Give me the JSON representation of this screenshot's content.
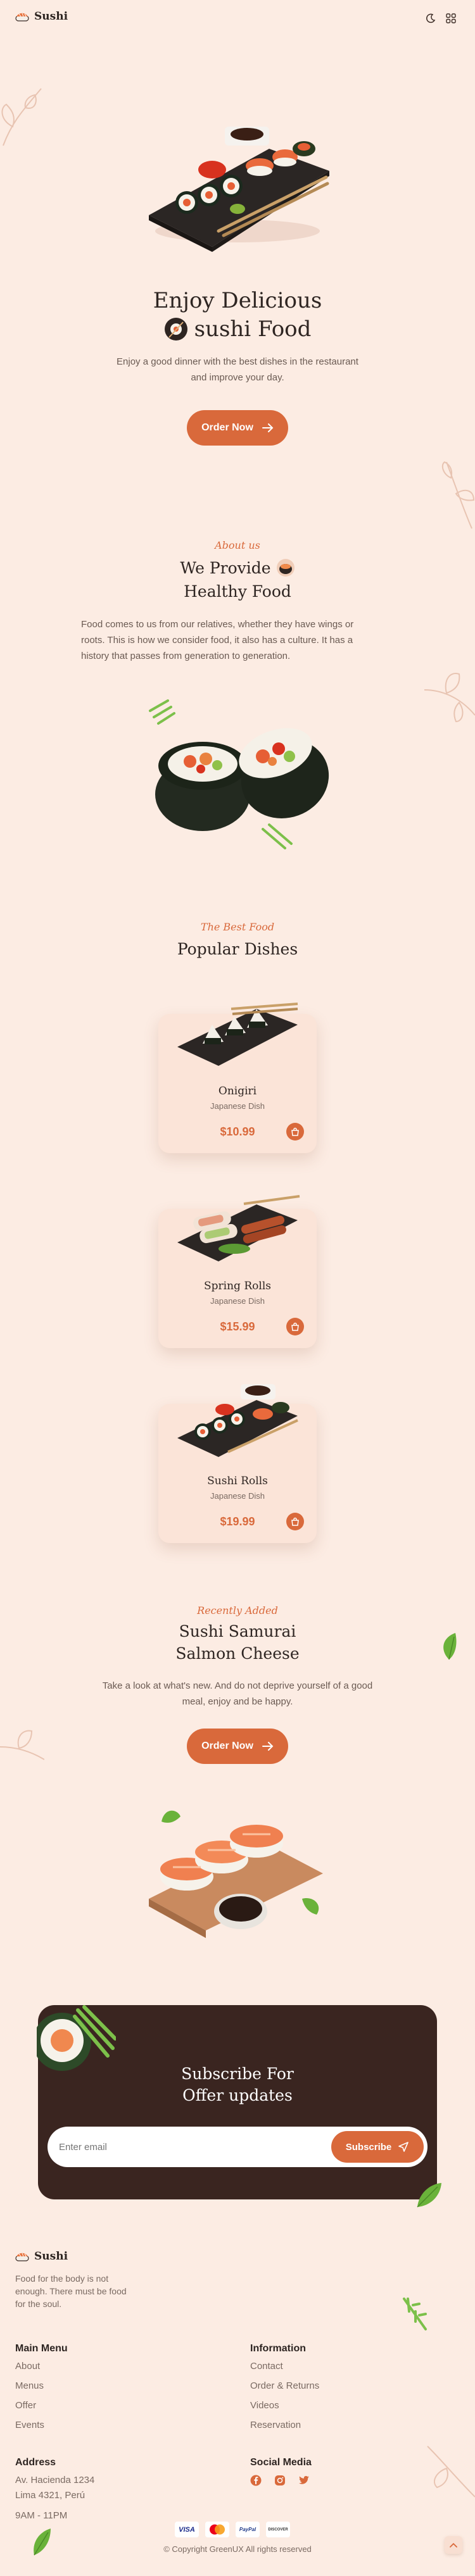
{
  "header": {
    "logo_text": "Sushi",
    "theme_icon": "moon-icon",
    "menu_icon": "grid-menu-icon"
  },
  "hero": {
    "title_line1": "Enjoy Delicious",
    "title_line2": "sushi Food",
    "description_line1": "Enjoy a good dinner with the best dishes in the restaurant",
    "description_line2": "and improve your day.",
    "cta_label": "Order Now"
  },
  "about": {
    "kicker": "About us",
    "title_line1": "We Provide",
    "title_line2": "Healthy Food",
    "text_line1": "Food comes to us from our relatives, whether they have wings or",
    "text_line2": "roots. This is how we consider food, it also has a culture. It has a",
    "text_line3": "history that passes from generation to generation."
  },
  "popular": {
    "kicker": "The Best Food",
    "title": "Popular Dishes",
    "items": [
      {
        "name": "Onigiri",
        "category": "Japanese Dish",
        "price": "$10.99"
      },
      {
        "name": "Spring Rolls",
        "category": "Japanese Dish",
        "price": "$15.99"
      },
      {
        "name": "Sushi Rolls",
        "category": "Japanese Dish",
        "price": "$19.99"
      }
    ]
  },
  "recent": {
    "kicker": "Recently Added",
    "title_line1": "Sushi Samurai",
    "title_line2": "Salmon Cheese",
    "text_line1": "Take a look at what's new. And do not deprive yourself of a good",
    "text_line2": "meal, enjoy and be happy.",
    "cta_label": "Order Now"
  },
  "subscribe": {
    "title_line1": "Subscribe For",
    "title_line2": "Offer updates",
    "email_placeholder": "Enter email",
    "button_label": "Subscribe"
  },
  "footer": {
    "logo_text": "Sushi",
    "tagline_line1": "Food for the body is not",
    "tagline_line2": "enough. There must be food",
    "tagline_line3": "for the soul.",
    "main_menu": {
      "title": "Main Menu",
      "links": [
        "About",
        "Menus",
        "Offer",
        "Events"
      ]
    },
    "information": {
      "title": "Information",
      "links": [
        "Contact",
        "Order & Returns",
        "Videos",
        "Reservation"
      ]
    },
    "address": {
      "title": "Address",
      "line1": "Av. Hacienda 1234",
      "line2": "Lima 4321, Perú",
      "hours": "9AM - 11PM"
    },
    "social": {
      "title": "Social Media",
      "icons": [
        "facebook-icon",
        "instagram-icon",
        "twitter-icon"
      ]
    },
    "payments": [
      "VISA",
      "mastercard",
      "PayPal",
      "DISCOVER"
    ],
    "copyright": "© Copyright GreenUX All rights reserved"
  },
  "colors": {
    "background": "#fcece3",
    "accent": "#d9693b",
    "dark_panel": "#3a2520",
    "card": "#fbe4d8"
  }
}
